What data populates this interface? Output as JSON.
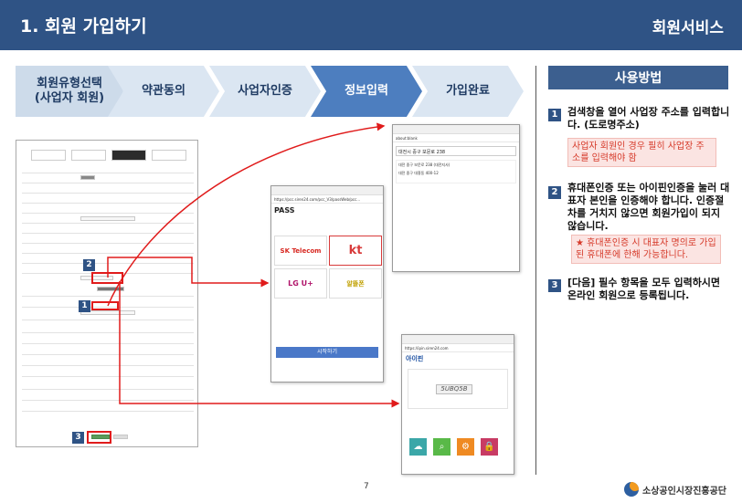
{
  "header": {
    "title": "1. 회원 가입하기",
    "right_label": "회원서비스",
    "bg_color": "#2f5385"
  },
  "steps": [
    {
      "label": "회원유형선택\n(사업자 회원)",
      "active": false
    },
    {
      "label": "약관동의",
      "active": false
    },
    {
      "label": "사업자인증",
      "active": false
    },
    {
      "label": "정보입력",
      "active": true
    },
    {
      "label": "가입완료",
      "active": false
    }
  ],
  "usage": {
    "title": "사용방법",
    "items": [
      {
        "num": "1",
        "text": "검색창을 열어 사업장 주소를 입력합니다. (도로명주소)",
        "note": "사업자 회원인 경우 필히 사업장 주소를 입력해야 함"
      },
      {
        "num": "2",
        "text": "휴대폰인증 또는 아이핀인증을 눌러 대표자 본인을 인증해야 합니다. 인증절차를 거치지 않으면 회원가입이 되지 않습니다.",
        "note": "★ 휴대폰인증 시 대표자 명의로 가입된 휴대폰에 한해 가능합니다."
      },
      {
        "num": "3",
        "text": "[다음] 필수 항목을 모두 입력하시면 온라인 회원으로 등록됩니다.",
        "note": ""
      }
    ]
  },
  "form_mock": {
    "badges": [
      "2",
      "1",
      "3"
    ]
  },
  "address_popup": {
    "url": "about:blank",
    "query": "대전시 중구 보문로 238",
    "results": [
      "대전 중구 보문로 238 (대전지사)",
      "대전 중구 대흥동 400-12"
    ]
  },
  "pass_popup": {
    "url": "https://pcc.siren24.com/pcc_V3/passWeb/pcc...",
    "title": "PASS",
    "carriers": [
      "SK Telecom",
      "kt",
      "LG U+",
      "알뜰폰"
    ],
    "submit": "시작하기"
  },
  "ipin_popup": {
    "url": "https://ipin.siren24.com",
    "brand": "아이핀",
    "captcha": "5UBQ5B"
  },
  "page_number": "7",
  "footer_logo": "소상공인시장진흥공단",
  "colors": {
    "accent": "#2f5385",
    "active_step": "#4d7ebf",
    "highlight": "#e01b1b"
  }
}
